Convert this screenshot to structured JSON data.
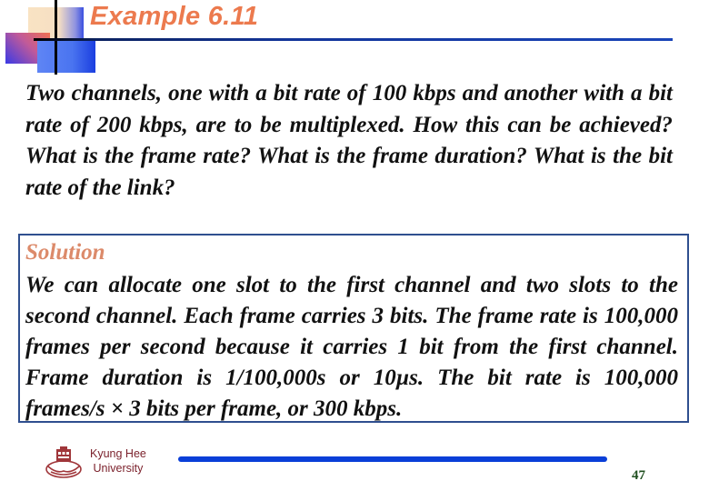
{
  "slide": {
    "title": "Example 6.11",
    "question": "Two channels, one with a bit rate of 100 kbps and another with a bit rate of 200 kbps, are to be multiplexed. How this can be achieved? What is the frame rate? What is the frame duration? What is the bit rate of the link?",
    "solution_label": "Solution",
    "solution_text": "We can allocate one slot to the first channel and two slots to the second channel. Each frame carries 3 bits. The frame rate is 100,000 frames per second because it carries 1 bit from the first channel. Frame duration is 1/100,000s or 10µs. The bit rate is 100,000 frames/s × 3 bits per frame, or 300 kbps."
  },
  "footer": {
    "logo_icon": "university-crest-icon",
    "university_line1": "Kyung Hee",
    "university_line2": "University",
    "page_number": "47"
  },
  "colors": {
    "title": "#ec7a4e",
    "solution_label": "#dc8a6a",
    "box_border": "#2f4f8f",
    "footer_bar": "#0a3fd8",
    "university_text": "#7a1f2a",
    "page_number": "#1f4f1f"
  }
}
